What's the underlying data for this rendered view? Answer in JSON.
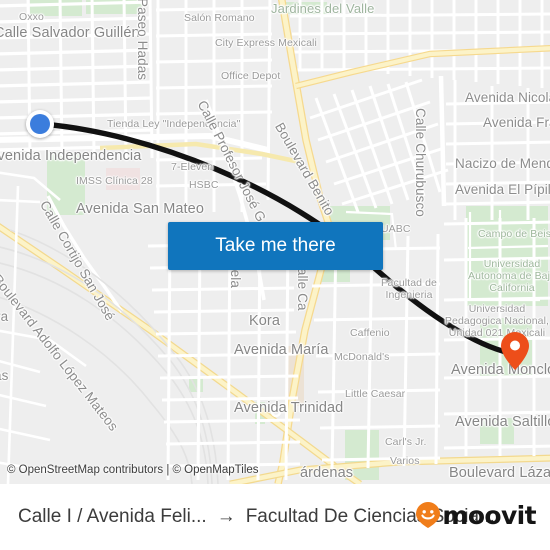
{
  "map": {
    "attribution": "© OpenStreetMap contributors | © OpenMapTiles",
    "origin_marker": "origin-dot",
    "destination_marker": "destination-pin",
    "colors": {
      "background": "#eeeeee",
      "road": "#ffffff",
      "highway": "#fbf0b5",
      "park": "#d6ebd0",
      "route_line": "#111111",
      "origin_blue": "#3b7ddd",
      "destination_orange": "#ed4e1a",
      "button_blue": "#1075bd"
    },
    "labels": [
      {
        "text": "Oxxo",
        "kind": "poi"
      },
      {
        "text": "Calle Salvador Guillén",
        "kind": "road"
      },
      {
        "text": "Paseo Hadas",
        "kind": "road"
      },
      {
        "text": "Salón Romano",
        "kind": "poi"
      },
      {
        "text": "Jardines del Valle",
        "kind": "area"
      },
      {
        "text": "City Express Mexicali",
        "kind": "poi"
      },
      {
        "text": "Office Depot",
        "kind": "poi"
      },
      {
        "text": "Avenida Nicolá",
        "kind": "road"
      },
      {
        "text": "Avenida Fra",
        "kind": "road"
      },
      {
        "text": "Tienda Ley \"Independencia\"",
        "kind": "poi"
      },
      {
        "text": "Avenida Independencia",
        "kind": "road"
      },
      {
        "text": "Calle Profesor José G.",
        "kind": "road"
      },
      {
        "text": "Boulevard Benito",
        "kind": "road"
      },
      {
        "text": "Calle Churubusco",
        "kind": "road"
      },
      {
        "text": "Nacizo de Mendo",
        "kind": "road"
      },
      {
        "text": "Avenida El Pípila",
        "kind": "road"
      },
      {
        "text": "7-Eleven",
        "kind": "poi"
      },
      {
        "text": "IMSS Clínica 28",
        "kind": "poi"
      },
      {
        "text": "HSBC",
        "kind": "poi"
      },
      {
        "text": "Avenida San Mateo",
        "kind": "road"
      },
      {
        "text": "Calle Cortijo San José",
        "kind": "road"
      },
      {
        "text": "Boulevard Adolfo López Mateos",
        "kind": "road"
      },
      {
        "text": "UABC",
        "kind": "poi"
      },
      {
        "text": "Campo de Beisbol Infantil",
        "kind": "green"
      },
      {
        "text": "Universidad Autonoma de Baja California",
        "kind": "green"
      },
      {
        "text": "Facultad de Ingenieria",
        "kind": "poi"
      },
      {
        "text": "Universidad Pedagogica Nacional, Unidad 021 Mexicali",
        "kind": "poi"
      },
      {
        "text": "Kora",
        "kind": "road"
      },
      {
        "text": "Caffenio",
        "kind": "poi"
      },
      {
        "text": "Avenida María",
        "kind": "road"
      },
      {
        "text": "McDonald's",
        "kind": "poi"
      },
      {
        "text": "Avenida Monclov",
        "kind": "road"
      },
      {
        "text": "Little Caesar",
        "kind": "poi"
      },
      {
        "text": "Avenida Trinidad",
        "kind": "road"
      },
      {
        "text": "Avenida Saltillo",
        "kind": "road"
      },
      {
        "text": "Carl's Jr.",
        "kind": "poi"
      },
      {
        "text": "Varios",
        "kind": "poi"
      },
      {
        "text": "árdenas",
        "kind": "road"
      },
      {
        "text": "Boulevard Lázaro",
        "kind": "road"
      },
      {
        "text": "Calle Ca",
        "kind": "road"
      },
      {
        "text": "uela",
        "kind": "road"
      },
      {
        "text": "ra",
        "kind": "road"
      },
      {
        "text": "as",
        "kind": "road"
      }
    ]
  },
  "button": {
    "take_me_there": "Take me there"
  },
  "footer": {
    "origin": "Calle I / Avenida Feli...",
    "arrow": "→",
    "destination": "Facultad De Ciencias Socia...",
    "brand": "moovit"
  }
}
